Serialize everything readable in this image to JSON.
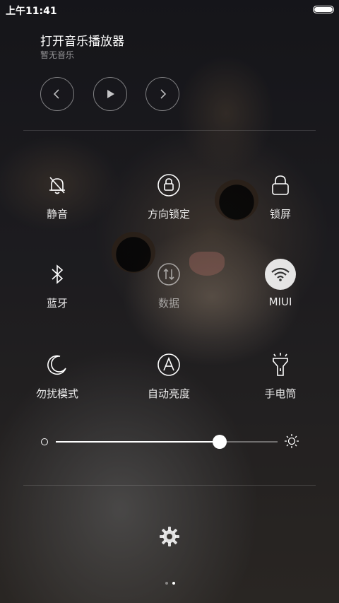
{
  "status_bar": {
    "time": "上午11:41",
    "battery_level": 1.0
  },
  "music": {
    "title": "打开音乐播放器",
    "subtitle": "暂无音乐",
    "prev_icon": "chevron-left-icon",
    "play_icon": "play-icon",
    "next_icon": "chevron-right-icon"
  },
  "toggles": [
    {
      "label": "静音",
      "icon": "bell-off-icon",
      "active": false
    },
    {
      "label": "方向锁定",
      "icon": "rotation-lock-icon",
      "active": false
    },
    {
      "label": "锁屏",
      "icon": "lock-icon",
      "active": false
    },
    {
      "label": "蓝牙",
      "icon": "bluetooth-icon",
      "active": false
    },
    {
      "label": "数据",
      "icon": "mobile-data-icon",
      "active": false
    },
    {
      "label": "MIUI",
      "icon": "wifi-icon",
      "active": true
    },
    {
      "label": "勿扰模式",
      "icon": "moon-icon",
      "active": false
    },
    {
      "label": "自动亮度",
      "icon": "auto-brightness-icon",
      "active": false
    },
    {
      "label": "手电筒",
      "icon": "flashlight-icon",
      "active": false
    }
  ],
  "brightness": {
    "level": 0.74
  },
  "pager": {
    "pages": 2,
    "current": 2
  },
  "colors": {
    "active_toggle_bg": "#ffffff",
    "accent": "#ffffff"
  }
}
